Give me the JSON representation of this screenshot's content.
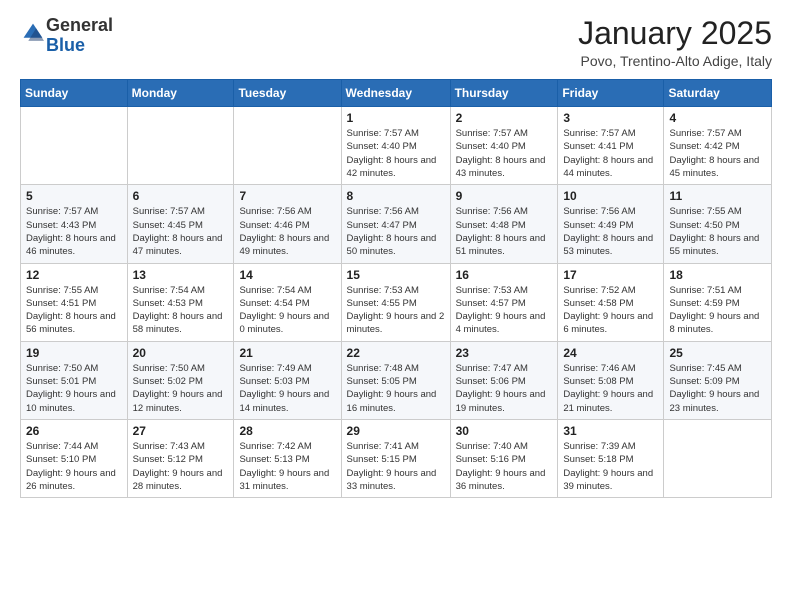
{
  "logo": {
    "general": "General",
    "blue": "Blue"
  },
  "header": {
    "title": "January 2025",
    "subtitle": "Povo, Trentino-Alto Adige, Italy"
  },
  "weekdays": [
    "Sunday",
    "Monday",
    "Tuesday",
    "Wednesday",
    "Thursday",
    "Friday",
    "Saturday"
  ],
  "weeks": [
    [
      {
        "day": "",
        "info": ""
      },
      {
        "day": "",
        "info": ""
      },
      {
        "day": "",
        "info": ""
      },
      {
        "day": "1",
        "info": "Sunrise: 7:57 AM\nSunset: 4:40 PM\nDaylight: 8 hours and 42 minutes."
      },
      {
        "day": "2",
        "info": "Sunrise: 7:57 AM\nSunset: 4:40 PM\nDaylight: 8 hours and 43 minutes."
      },
      {
        "day": "3",
        "info": "Sunrise: 7:57 AM\nSunset: 4:41 PM\nDaylight: 8 hours and 44 minutes."
      },
      {
        "day": "4",
        "info": "Sunrise: 7:57 AM\nSunset: 4:42 PM\nDaylight: 8 hours and 45 minutes."
      }
    ],
    [
      {
        "day": "5",
        "info": "Sunrise: 7:57 AM\nSunset: 4:43 PM\nDaylight: 8 hours and 46 minutes."
      },
      {
        "day": "6",
        "info": "Sunrise: 7:57 AM\nSunset: 4:45 PM\nDaylight: 8 hours and 47 minutes."
      },
      {
        "day": "7",
        "info": "Sunrise: 7:56 AM\nSunset: 4:46 PM\nDaylight: 8 hours and 49 minutes."
      },
      {
        "day": "8",
        "info": "Sunrise: 7:56 AM\nSunset: 4:47 PM\nDaylight: 8 hours and 50 minutes."
      },
      {
        "day": "9",
        "info": "Sunrise: 7:56 AM\nSunset: 4:48 PM\nDaylight: 8 hours and 51 minutes."
      },
      {
        "day": "10",
        "info": "Sunrise: 7:56 AM\nSunset: 4:49 PM\nDaylight: 8 hours and 53 minutes."
      },
      {
        "day": "11",
        "info": "Sunrise: 7:55 AM\nSunset: 4:50 PM\nDaylight: 8 hours and 55 minutes."
      }
    ],
    [
      {
        "day": "12",
        "info": "Sunrise: 7:55 AM\nSunset: 4:51 PM\nDaylight: 8 hours and 56 minutes."
      },
      {
        "day": "13",
        "info": "Sunrise: 7:54 AM\nSunset: 4:53 PM\nDaylight: 8 hours and 58 minutes."
      },
      {
        "day": "14",
        "info": "Sunrise: 7:54 AM\nSunset: 4:54 PM\nDaylight: 9 hours and 0 minutes."
      },
      {
        "day": "15",
        "info": "Sunrise: 7:53 AM\nSunset: 4:55 PM\nDaylight: 9 hours and 2 minutes."
      },
      {
        "day": "16",
        "info": "Sunrise: 7:53 AM\nSunset: 4:57 PM\nDaylight: 9 hours and 4 minutes."
      },
      {
        "day": "17",
        "info": "Sunrise: 7:52 AM\nSunset: 4:58 PM\nDaylight: 9 hours and 6 minutes."
      },
      {
        "day": "18",
        "info": "Sunrise: 7:51 AM\nSunset: 4:59 PM\nDaylight: 9 hours and 8 minutes."
      }
    ],
    [
      {
        "day": "19",
        "info": "Sunrise: 7:50 AM\nSunset: 5:01 PM\nDaylight: 9 hours and 10 minutes."
      },
      {
        "day": "20",
        "info": "Sunrise: 7:50 AM\nSunset: 5:02 PM\nDaylight: 9 hours and 12 minutes."
      },
      {
        "day": "21",
        "info": "Sunrise: 7:49 AM\nSunset: 5:03 PM\nDaylight: 9 hours and 14 minutes."
      },
      {
        "day": "22",
        "info": "Sunrise: 7:48 AM\nSunset: 5:05 PM\nDaylight: 9 hours and 16 minutes."
      },
      {
        "day": "23",
        "info": "Sunrise: 7:47 AM\nSunset: 5:06 PM\nDaylight: 9 hours and 19 minutes."
      },
      {
        "day": "24",
        "info": "Sunrise: 7:46 AM\nSunset: 5:08 PM\nDaylight: 9 hours and 21 minutes."
      },
      {
        "day": "25",
        "info": "Sunrise: 7:45 AM\nSunset: 5:09 PM\nDaylight: 9 hours and 23 minutes."
      }
    ],
    [
      {
        "day": "26",
        "info": "Sunrise: 7:44 AM\nSunset: 5:10 PM\nDaylight: 9 hours and 26 minutes."
      },
      {
        "day": "27",
        "info": "Sunrise: 7:43 AM\nSunset: 5:12 PM\nDaylight: 9 hours and 28 minutes."
      },
      {
        "day": "28",
        "info": "Sunrise: 7:42 AM\nSunset: 5:13 PM\nDaylight: 9 hours and 31 minutes."
      },
      {
        "day": "29",
        "info": "Sunrise: 7:41 AM\nSunset: 5:15 PM\nDaylight: 9 hours and 33 minutes."
      },
      {
        "day": "30",
        "info": "Sunrise: 7:40 AM\nSunset: 5:16 PM\nDaylight: 9 hours and 36 minutes."
      },
      {
        "day": "31",
        "info": "Sunrise: 7:39 AM\nSunset: 5:18 PM\nDaylight: 9 hours and 39 minutes."
      },
      {
        "day": "",
        "info": ""
      }
    ]
  ]
}
